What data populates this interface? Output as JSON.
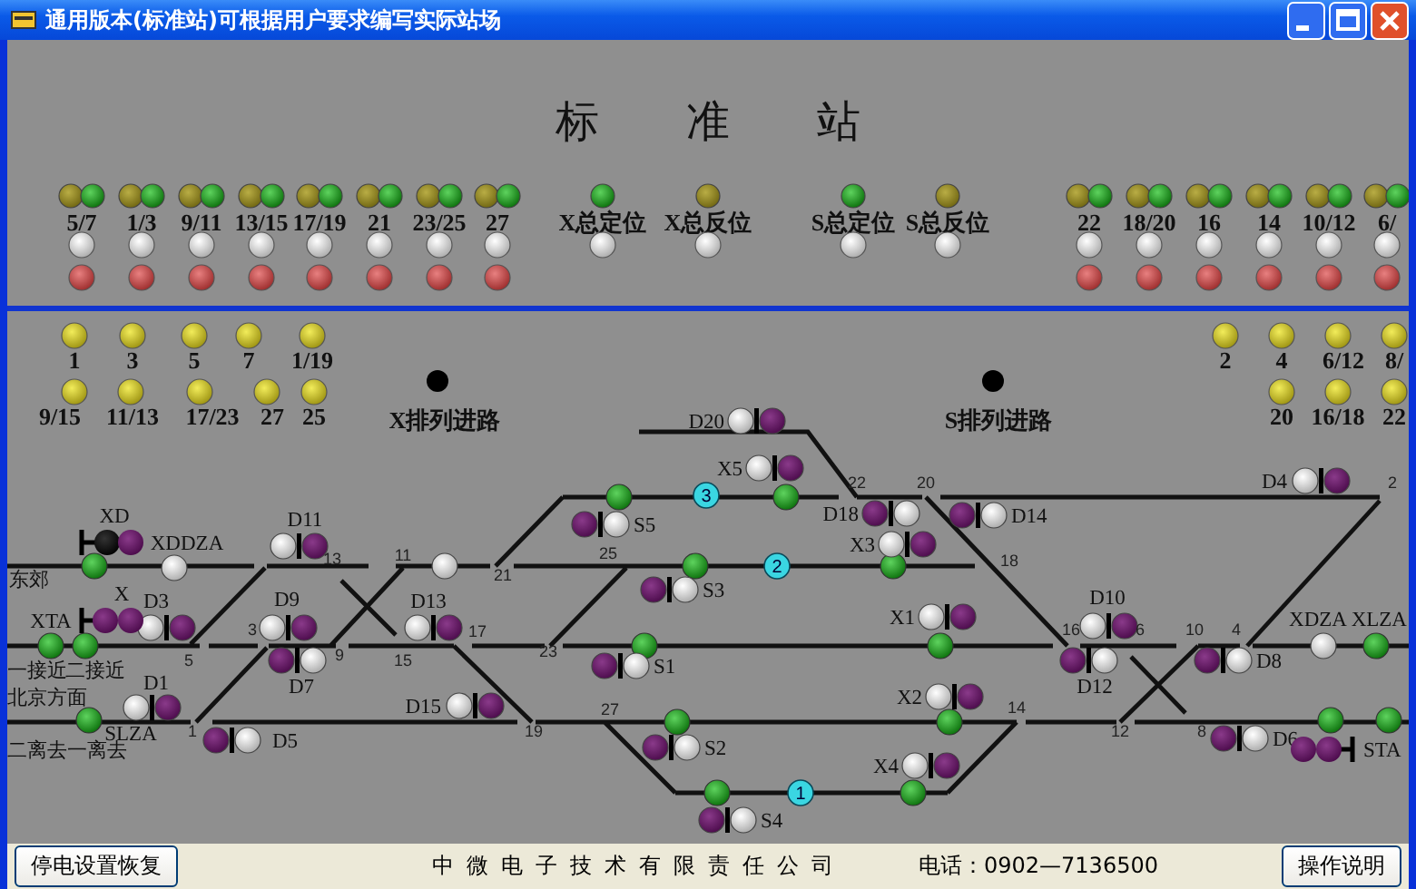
{
  "window": {
    "title": "通用版本(标准站)可根据用户要求编写实际站场"
  },
  "heading": "标准站",
  "switch_panel": {
    "left_switches": [
      {
        "label": "5/7"
      },
      {
        "label": "1/3"
      },
      {
        "label": "9/11"
      },
      {
        "label": "13/15"
      },
      {
        "label": "17/19"
      },
      {
        "label": "21"
      },
      {
        "label": "23/25"
      },
      {
        "label": "27"
      }
    ],
    "general_controls": [
      {
        "label": "X总定位",
        "kind": "normal"
      },
      {
        "label": "X总反位",
        "kind": "reverse"
      },
      {
        "label": "S总定位",
        "kind": "normal"
      },
      {
        "label": "S总反位",
        "kind": "reverse"
      }
    ],
    "right_switches": [
      {
        "label": "22"
      },
      {
        "label": "18/20"
      },
      {
        "label": "16"
      },
      {
        "label": "14"
      },
      {
        "label": "10/12"
      },
      {
        "label": "6/"
      }
    ]
  },
  "route_panel": {
    "left_buttons": [
      {
        "label": "1"
      },
      {
        "label": "3"
      },
      {
        "label": "5"
      },
      {
        "label": "7"
      },
      {
        "label": "1/19"
      },
      {
        "label": "9/15"
      },
      {
        "label": "11/13"
      },
      {
        "label": "17/23"
      },
      {
        "label": "27"
      },
      {
        "label": "25"
      }
    ],
    "route_buttons": [
      {
        "label": "X排列进路"
      },
      {
        "label": "S排列进路"
      }
    ],
    "right_buttons": [
      {
        "label": "2"
      },
      {
        "label": "4"
      },
      {
        "label": "6/12"
      },
      {
        "label": "8/"
      },
      {
        "label": "20"
      },
      {
        "label": "16/18"
      },
      {
        "label": "22"
      }
    ]
  },
  "track_diagram": {
    "shunt_signals": [
      {
        "label": "D11"
      },
      {
        "label": "D3"
      },
      {
        "label": "D9"
      },
      {
        "label": "D7"
      },
      {
        "label": "D13"
      },
      {
        "label": "D1"
      },
      {
        "label": "D5"
      },
      {
        "label": "D15"
      },
      {
        "label": "S5"
      },
      {
        "label": "S3"
      },
      {
        "label": "S1"
      },
      {
        "label": "S2"
      },
      {
        "label": "S4"
      },
      {
        "label": "D20"
      },
      {
        "label": "X5"
      },
      {
        "label": "D18"
      },
      {
        "label": "D14"
      },
      {
        "label": "X3"
      },
      {
        "label": "X1"
      },
      {
        "label": "D10"
      },
      {
        "label": "D12"
      },
      {
        "label": "X2"
      },
      {
        "label": "X4"
      },
      {
        "label": "D8"
      },
      {
        "label": "D4"
      },
      {
        "label": "D6"
      }
    ],
    "entry_signals": [
      {
        "label": "XD"
      },
      {
        "label": "X"
      },
      {
        "label": "STA"
      }
    ],
    "section_labels": [
      {
        "label": "XDDZA"
      },
      {
        "label": "XTA"
      },
      {
        "label": "SLZA"
      },
      {
        "label": "XDZA"
      },
      {
        "label": "XLZA"
      }
    ],
    "switch_numbers": [
      "13",
      "11",
      "21",
      "25",
      "5",
      "3",
      "9",
      "15",
      "17",
      "23",
      "1",
      "19",
      "27",
      "22",
      "20",
      "18",
      "16",
      "6",
      "10",
      "4",
      "2",
      "12",
      "14",
      "8"
    ],
    "track_markers": [
      "3",
      "2",
      "1"
    ],
    "places": [
      "东郊",
      "一接近",
      "二接近",
      "北京方面",
      "二离去一离去"
    ]
  },
  "bottom_bar": {
    "left_button": "停电设置恢复",
    "company": "中微电子技术有限责任公司",
    "phone": "电话：0902—7136500",
    "right_button": "操作说明"
  }
}
